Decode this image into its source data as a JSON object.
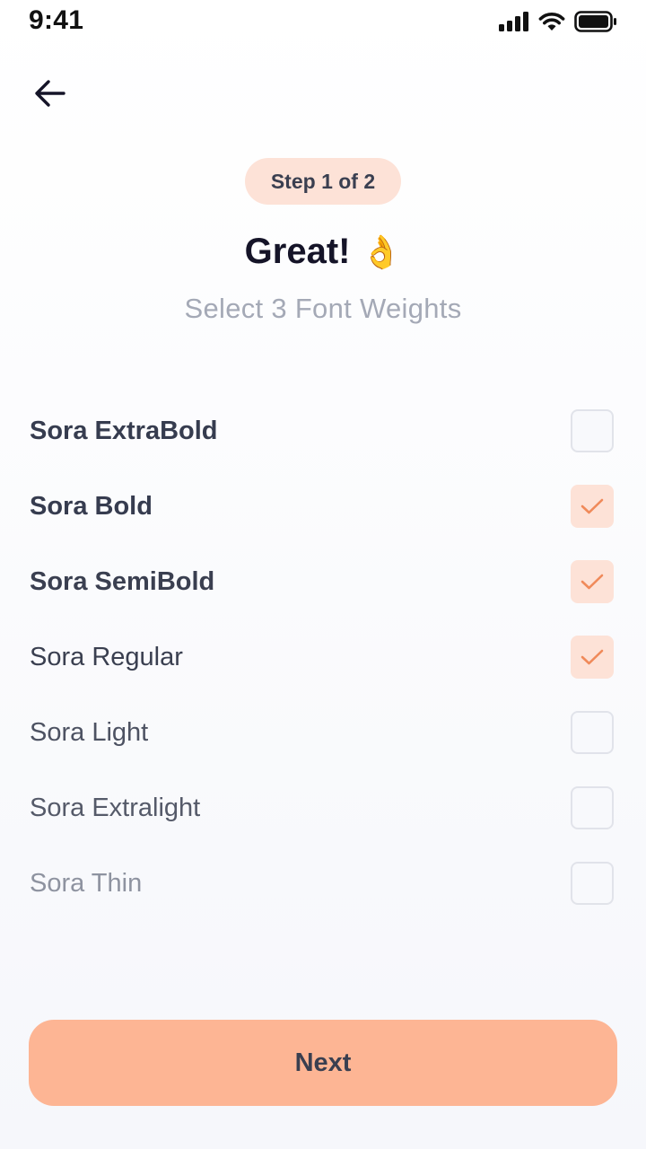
{
  "status_bar": {
    "time": "9:41",
    "icons": [
      "signal-icon",
      "wifi-icon",
      "battery-icon"
    ]
  },
  "header": {
    "back_icon": "arrow-left-icon"
  },
  "step": {
    "label": "Step 1 of 2"
  },
  "title": {
    "text": "Great!",
    "emoji": "👌"
  },
  "subtitle": "Select 3 Font Weights",
  "weights": [
    {
      "label": "Sora ExtraBold",
      "checked": false
    },
    {
      "label": "Sora Bold",
      "checked": true
    },
    {
      "label": "Sora SemiBold",
      "checked": true
    },
    {
      "label": "Sora Regular",
      "checked": true
    },
    {
      "label": "Sora Light",
      "checked": false
    },
    {
      "label": "Sora Extralight",
      "checked": false
    },
    {
      "label": "Sora Thin",
      "checked": false
    }
  ],
  "next_button": {
    "label": "Next"
  },
  "colors": {
    "accent": "#FDB594",
    "accent_light": "#FDE2D7",
    "check": "#F08A5A",
    "title": "#151428",
    "subtitle": "#A4A9B6"
  }
}
